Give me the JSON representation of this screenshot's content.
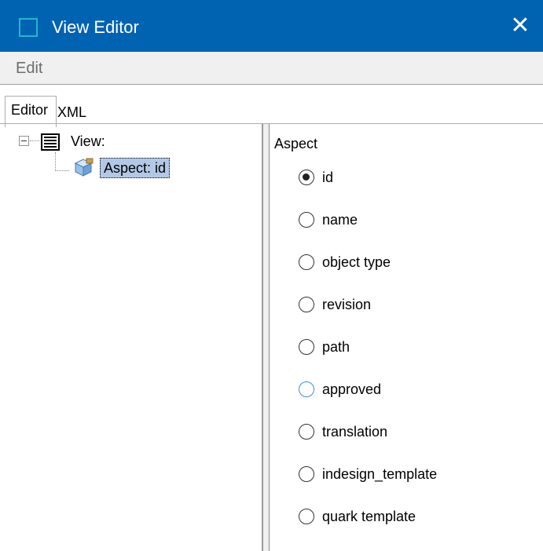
{
  "window": {
    "title": "View Editor",
    "close_glyph": "✕",
    "titlebar_color": "#0063b1"
  },
  "menu": {
    "items": [
      {
        "label": "Edit"
      }
    ]
  },
  "tabs": [
    {
      "label": "Editor",
      "selected": true
    },
    {
      "label": "XML",
      "selected": false
    }
  ],
  "tree": {
    "root": {
      "label": "View:",
      "icon": "list-document-icon",
      "expanded": true
    },
    "child": {
      "label": "Aspect: id",
      "icon": "aspect-cube-icon",
      "selected": true
    }
  },
  "aspect_panel": {
    "heading": "Aspect",
    "options": [
      {
        "label": "id",
        "checked": true
      },
      {
        "label": "name",
        "checked": false
      },
      {
        "label": "object type",
        "checked": false
      },
      {
        "label": "revision",
        "checked": false
      },
      {
        "label": "path",
        "checked": false
      },
      {
        "label": "approved",
        "checked": false,
        "hovered": true
      },
      {
        "label": "translation",
        "checked": false
      },
      {
        "label": "indesign_template",
        "checked": false
      },
      {
        "label": "quark template",
        "checked": false
      }
    ]
  }
}
